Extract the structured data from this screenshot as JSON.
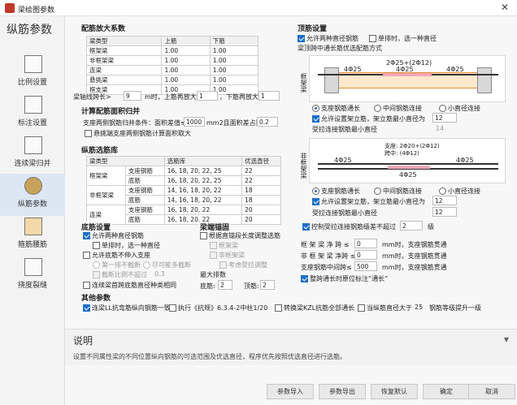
{
  "window": {
    "title": "梁绘图参数"
  },
  "sidebar": {
    "heading": "纵筋参数",
    "items": [
      {
        "label": "比例设置"
      },
      {
        "label": "标注设置"
      },
      {
        "label": "连续梁归并"
      },
      {
        "label": "纵筋参数"
      },
      {
        "label": "箍筋腰筋"
      },
      {
        "label": "挠度裂缝"
      }
    ]
  },
  "amplify": {
    "title": "配筋放大系数",
    "headers": [
      "梁类型",
      "上筋",
      "下筋"
    ],
    "rows": [
      [
        "框架梁",
        "1.00",
        "1.00"
      ],
      [
        "非框架梁",
        "1.00",
        "1.00"
      ],
      [
        "连梁",
        "1.00",
        "1.00"
      ],
      [
        "悬挑梁",
        "1.00",
        "1.00"
      ],
      [
        "框支梁",
        "1.00",
        "1.00"
      ]
    ],
    "line_label1": "梁轴线跨长>",
    "span": "9",
    "line_label2": "m时，上筋再放大",
    "top_factor": "1",
    "line_label3": "，下筋再放大",
    "bottom_factor": "1"
  },
  "area_merge": {
    "title": "计算配筋面积归并",
    "label1": "支座两侧钢筋归并条件：面积差值≤",
    "diff": "1000",
    "label2": "mm2且面积差占比≤",
    "ratio": "0.2",
    "cantilever_label": "悬挑端支座两侧钢筋计算面积取大"
  },
  "library": {
    "title": "纵筋选筋库",
    "headers": [
      "梁类型",
      "",
      "选筋库",
      "优选直径"
    ],
    "rows": [
      [
        "框架梁",
        "支座钢筋",
        "16, 18, 20, 22, 25",
        "22"
      ],
      [
        "",
        "底筋",
        "16, 18, 20, 22, 25",
        "22"
      ],
      [
        "非框架梁",
        "支座钢筋",
        "14, 16, 18, 20, 22",
        "18"
      ],
      [
        "",
        "底筋",
        "14, 16, 18, 20, 22",
        "18"
      ],
      [
        "连梁",
        "支座钢筋",
        "16, 18, 20, 22",
        "20"
      ],
      [
        "",
        "底筋",
        "16, 18, 20, 22",
        "20"
      ]
    ]
  },
  "bottom_bars": {
    "title": "底筋设置",
    "allow_two": "允许两种直径钢筋",
    "single_row": "单排时，选一种直径",
    "allow_not_in_support": "允许底筋不伸入支座",
    "first_row": "第一排不截断",
    "second_row": "尽可能多截断",
    "ratio_label": "截断比例不超过",
    "ratio": "0.3",
    "continuous": "连续梁首跨底筋直径种类相同"
  },
  "anchor": {
    "title": "梁端锚固",
    "by_depth": "根据直锚段长度调整选筋",
    "frame": "框架梁",
    "nonframe": "非框架梁",
    "consider_resist": "考虑受拉调整",
    "max_rows_title": "最大排数",
    "bottom_label": "底筋:",
    "bottom_val": "2",
    "top_label": "顶筋:",
    "top_val": "2"
  },
  "others": {
    "title": "其他参数",
    "link_label": "连梁LL抗弯筋纵向钢筋一致",
    "exec_label": "执行《抗规》6.3.4-2中柱1/20",
    "kzl_label": "转换梁KZL抗筋全部通长",
    "when_label": "当纵筋直径大于",
    "when_val": "25",
    "when_tail": "钢筋等级提升一级"
  },
  "top_bars": {
    "title": "顶筋设置",
    "allow_two": "允许两种直径钢筋",
    "single_row": "单排时，选一种直径",
    "sub_title": "梁顶跨中通长筋优选配筋方式",
    "frame_tag": "框架梁",
    "nonframe_tag": "非框架梁",
    "frame_top_label": "2Φ25+(2Φ12)",
    "frame_l1": "4Φ25",
    "frame_l2": "4Φ25",
    "frame_l3": "4Φ25",
    "nf_top_label1": "支座: 2Φ20+(2Φ12)",
    "nf_top_label2": "跨中: (4Φ12)",
    "nf_l1": "4Φ25",
    "nf_l2": "4Φ25",
    "nf_l3": "4Φ25",
    "r_support": "支座钢筋通长",
    "r_mid": "中间钢筋连接",
    "r_small": "小直径连接",
    "allow_erect": "允许设置架立筋，架立筋最小直径为",
    "frame_erect_min": "12",
    "frame_tension_label": "受拉连接钢筋最小直径",
    "frame_tension_val": "14",
    "nf_erect_min": "12",
    "nf_tension_label": "受拉连接钢筋最小直径",
    "nf_tension_val": "12",
    "control_label": "控制受拉连接钢筋级差不超过",
    "control_val": "2",
    "control_unit": "级"
  },
  "right_params": {
    "row1_label": "框 架 梁 净 跨 ≤",
    "row1_val": "0",
    "row1_tail": "mm时，支座钢筋贯通",
    "row2_label": "非 框 架 梁 净跨 ≤",
    "row2_val": "0",
    "row2_tail": "mm时，支座钢筋贯通",
    "row3_label": "支座钢筋中间跨≤",
    "row3_val": "500",
    "row3_tail": "mm时，支座钢筋贯通",
    "all_long": "整跨通长时原位标注“通长”"
  },
  "description": {
    "heading": "说明",
    "text": "设置不同属性梁的不同位置纵向钢筋的可选范围及优选直径，程序优先按照优选直径进行选筋。"
  },
  "footer": {
    "import": "参数导入",
    "export": "参数导出",
    "reset": "恢复默认",
    "ok": "确定",
    "cancel": "取消"
  }
}
